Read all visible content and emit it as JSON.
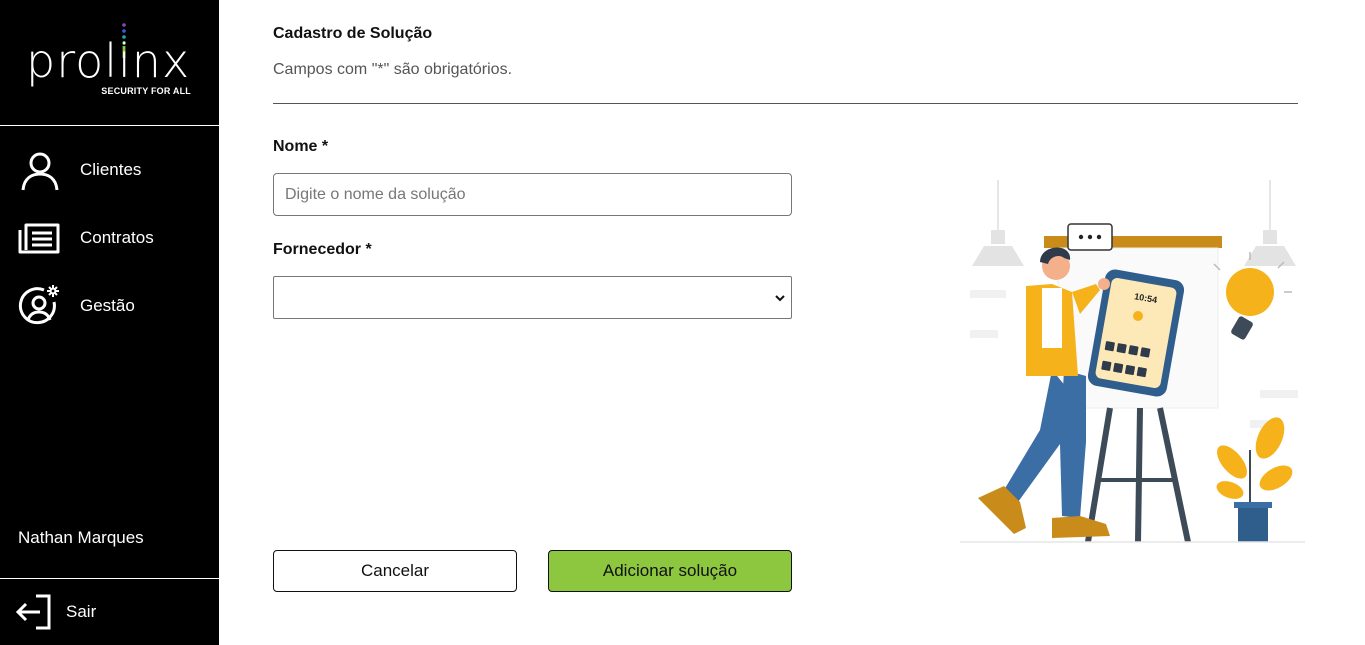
{
  "app": {
    "logo_text": "prolinx",
    "logo_tagline": "SECURITY FOR ALL"
  },
  "sidebar": {
    "items": [
      {
        "label": "Clientes",
        "icon": "user-icon"
      },
      {
        "label": "Contratos",
        "icon": "document-list-icon"
      },
      {
        "label": "Gestão",
        "icon": "user-gear-icon"
      }
    ],
    "user_name": "Nathan Marques",
    "logout_label": "Sair"
  },
  "form": {
    "title": "Cadastro de Solução",
    "subtitle": "Campos com \"*\" são obrigatórios.",
    "name_label": "Nome *",
    "name_placeholder": "Digite o nome da solução",
    "name_value": "",
    "supplier_label": "Fornecedor *",
    "supplier_value": "",
    "cancel_label": "Cancelar",
    "submit_label": "Adicionar solução"
  },
  "illustration": {
    "phone_time": "10:54"
  },
  "colors": {
    "sidebar_bg": "#000000",
    "accent_green": "#8dc63f",
    "illustration_yellow": "#f5b21b",
    "illustration_blue": "#3a6ea5"
  }
}
